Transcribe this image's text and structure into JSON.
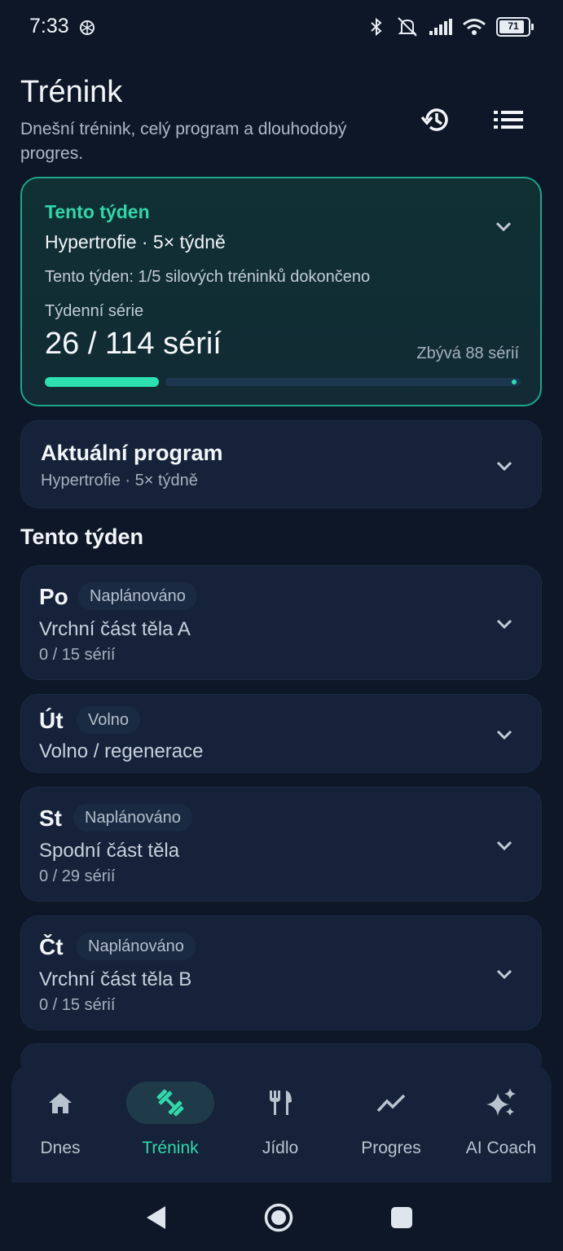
{
  "status": {
    "time": "7:33",
    "battery": "71"
  },
  "header": {
    "title": "Trénink",
    "subtitle": "Dnešní trénink, celý program a dlouhodobý progres."
  },
  "week_card": {
    "label": "Tento týden",
    "program": "Hypertrofie · 5× týdně",
    "note": "Tento týden: 1/5 silových tréninků dokončeno",
    "sets_label": "Týdenní série",
    "sets_value": "26 / 114 sérií",
    "remaining": "Zbývá 88 sérií",
    "progress_fraction": 0.228
  },
  "program_card": {
    "title": "Aktuální program",
    "subtitle": "Hypertrofie · 5× týdně"
  },
  "section_title": "Tento týden",
  "days": [
    {
      "day": "Po",
      "status": "Naplánováno",
      "workout": "Vrchní část těla A",
      "sets": "0 / 15 sérií"
    },
    {
      "day": "Út",
      "status": "Volno",
      "workout": "Volno / regenerace",
      "sets": ""
    },
    {
      "day": "St",
      "status": "Naplánováno",
      "workout": "Spodní část těla",
      "sets": "0 / 29 sérií"
    },
    {
      "day": "Čt",
      "status": "Naplánováno",
      "workout": "Vrchní část těla B",
      "sets": "0 / 15 sérií"
    }
  ],
  "nav": [
    {
      "label": "Dnes",
      "icon": "home-icon"
    },
    {
      "label": "Trénink",
      "icon": "dumbbell-icon",
      "active": true
    },
    {
      "label": "Jídlo",
      "icon": "fork-knife-icon"
    },
    {
      "label": "Progres",
      "icon": "trend-icon"
    },
    {
      "label": "AI Coach",
      "icon": "sparkle-icon"
    }
  ],
  "colors": {
    "accent": "#2de0b0",
    "background": "#0d1727",
    "card": "#15223a"
  }
}
